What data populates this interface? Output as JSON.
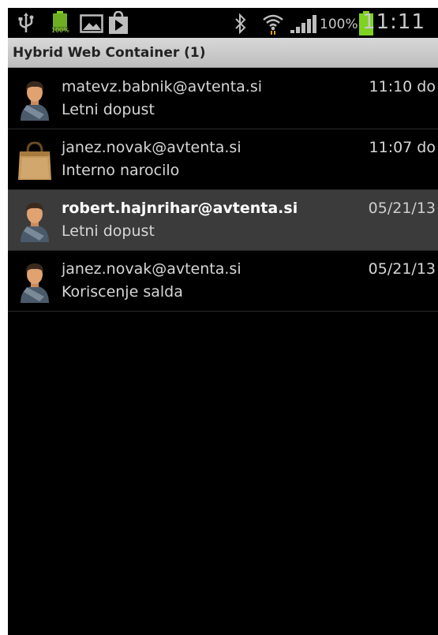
{
  "status_bar": {
    "icons": [
      "usb-icon",
      "battery-full-icon",
      "image-icon",
      "play-store-icon",
      "bluetooth-icon",
      "wifi-icon",
      "signal-icon",
      "battery-icon"
    ],
    "battery_small_label": "100%",
    "battery_percent": "100%",
    "time": "11:11"
  },
  "app": {
    "title": "Hybrid Web Container (1)"
  },
  "messages": [
    {
      "sender": "matevz.babnik@avtenta.si",
      "subject": "Letni dopust",
      "time": "11:10 do",
      "icon": "person-icon",
      "selected": false
    },
    {
      "sender": "janez.novak@avtenta.si",
      "subject": "Interno narocilo",
      "time": "11:07 do",
      "icon": "shopping-bag-icon",
      "selected": false
    },
    {
      "sender": "robert.hajnrihar@avtenta.si",
      "subject": "Letni dopust",
      "time": "05/21/13",
      "icon": "person-icon",
      "selected": true
    },
    {
      "sender": "janez.novak@avtenta.si",
      "subject": "Koriscenje salda",
      "time": "05/21/13",
      "icon": "person-icon",
      "selected": false
    }
  ],
  "colors": {
    "background": "#000000",
    "title_bar": "#c9c9c9",
    "selected_row": "#3b3b3b",
    "battery_green": "#7fd320"
  }
}
